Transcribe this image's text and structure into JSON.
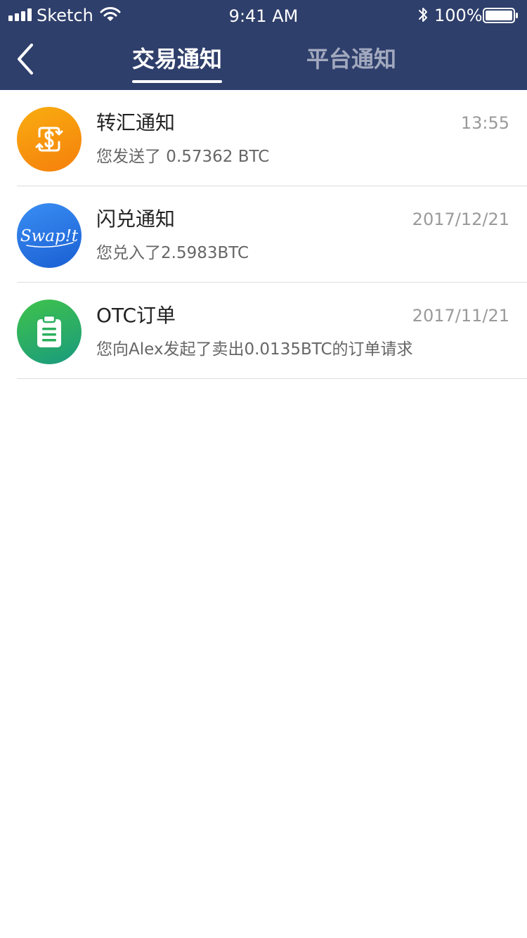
{
  "status_bar": {
    "carrier": "Sketch",
    "time": "9:41 AM",
    "battery": "100%"
  },
  "nav": {
    "tabs": [
      {
        "label": "交易通知",
        "active": true
      },
      {
        "label": "平台通知",
        "active": false
      }
    ]
  },
  "notifications": [
    {
      "title": "转汇通知",
      "date": "13:55",
      "description": "您发送了 0.57362 BTC",
      "icon": "dollar-exchange-icon",
      "color": "#f7960e"
    },
    {
      "title": "闪兑通知",
      "date": "2017/12/21",
      "description": "您兑入了2.5983BTC",
      "icon": "swapit-logo-icon",
      "color": "#2a77e6"
    },
    {
      "title": "OTC订单",
      "date": "2017/11/21",
      "description": "您向Alex发起了卖出0.0135BTC的订单请求",
      "icon": "clipboard-icon",
      "color": "#2bb05e"
    }
  ],
  "logos": {
    "swapit": "Swap!t"
  },
  "colors": {
    "header_bg": "#2f3f6b",
    "tab_active": "#ffffff",
    "tab_inactive": "#a2a9be"
  }
}
